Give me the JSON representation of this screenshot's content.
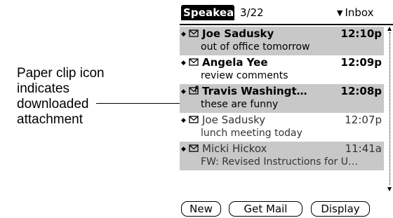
{
  "callout": {
    "lines": [
      "Paper clip icon",
      "indicates",
      "downloaded",
      "attachment"
    ]
  },
  "header": {
    "app_name": "Speakeas",
    "count": "3/22",
    "folder": "Inbox",
    "folder_icon": "triangle-down-icon"
  },
  "messages": [
    {
      "sender": "Joe Sadusky",
      "time": "12:10p",
      "subject": "out of office tomorrow",
      "unread": true,
      "icon": "envelope-icon",
      "shaded": true
    },
    {
      "sender": "Angela Yee",
      "time": "12:09p",
      "subject": "review comments",
      "unread": true,
      "icon": "envelope-icon",
      "shaded": false
    },
    {
      "sender": "Travis Washingt…",
      "time": "12:08p",
      "subject": "these are funny",
      "unread": true,
      "icon": "envelope-paperclip-icon",
      "shaded": true
    },
    {
      "sender": "Joe Sadusky",
      "time": "12:07p",
      "subject": "lunch meeting today",
      "unread": false,
      "icon": "envelope-icon",
      "shaded": false
    },
    {
      "sender": "Micki Hickox",
      "time": "11:41a",
      "subject": "FW: Revised Instructions for U…",
      "unread": false,
      "icon": "envelope-icon",
      "shaded": true
    }
  ],
  "buttons": {
    "new": "New",
    "get_mail": "Get Mail",
    "display": "Display"
  }
}
